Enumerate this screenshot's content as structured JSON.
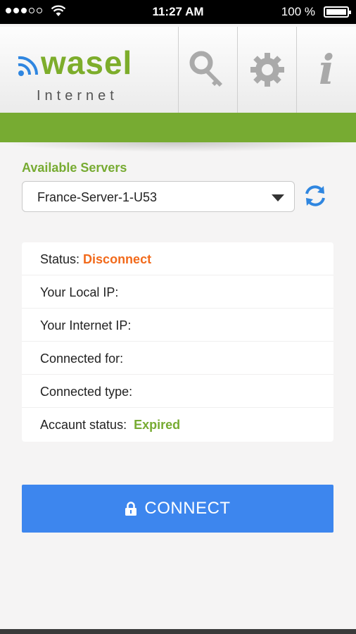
{
  "status_bar": {
    "time": "11:27 AM",
    "battery": "100 %"
  },
  "header": {
    "logo_word": "wasel",
    "logo_sub": "Internet",
    "buttons": [
      "key-icon",
      "gear-icon",
      "info-icon"
    ],
    "info_glyph": "i"
  },
  "colors": {
    "brand_green": "#77ab32",
    "connect_blue": "#3d86ee",
    "status_orange": "#f26a1b"
  },
  "servers": {
    "label": "Available Servers",
    "selected": "France-Server-1-U53"
  },
  "info": {
    "status_label": "Status:",
    "status_value": "Disconnect",
    "local_ip_label": "Your Local IP:",
    "internet_ip_label": "Your Internet IP:",
    "connected_for_label": "Connected for:",
    "connected_type_label": "Connected type:",
    "account_label": "Accaunt status:",
    "account_value": "Expired"
  },
  "connect": {
    "label": "CONNECT"
  }
}
